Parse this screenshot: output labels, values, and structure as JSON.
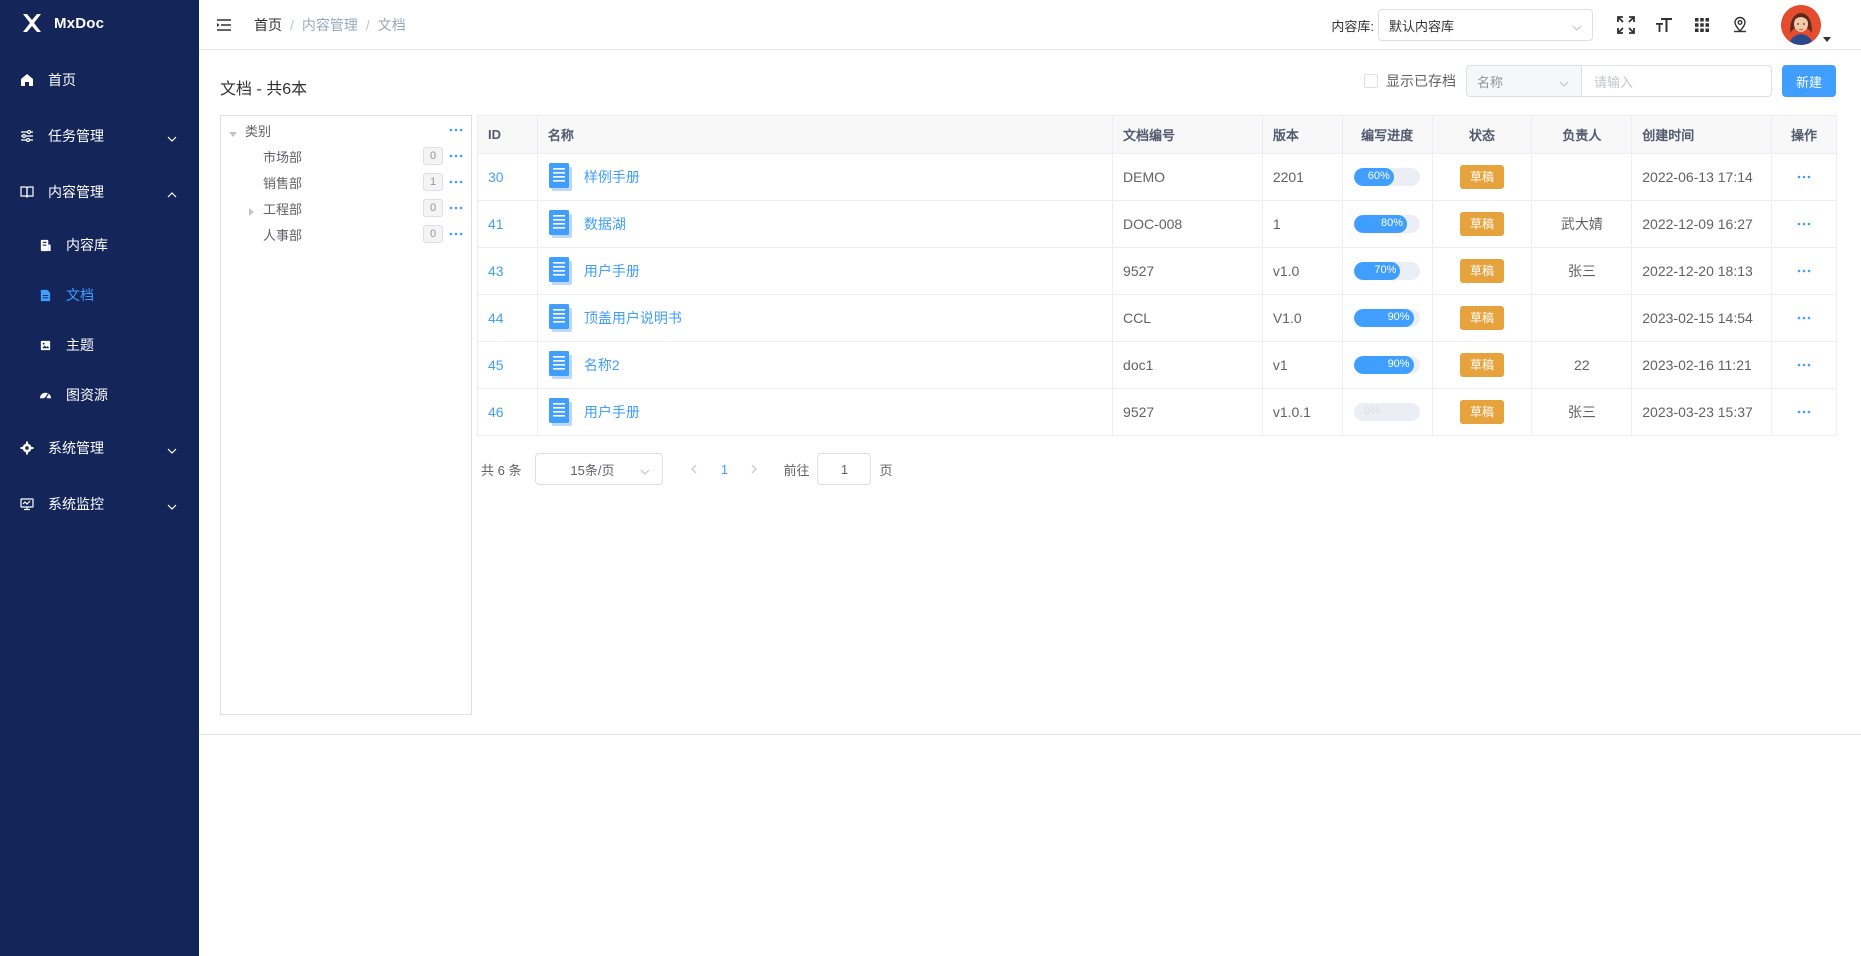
{
  "app": {
    "name": "MxDoc",
    "logo_small_text": "Mxdoc"
  },
  "colors": {
    "sidebar_bg": "#14255a",
    "primary": "#409eff",
    "draft_tag": "#e6a23c"
  },
  "sidebar": {
    "items": [
      {
        "label": "首页",
        "icon": "home-icon"
      },
      {
        "label": "任务管理",
        "icon": "sliders-icon",
        "expanded": false
      },
      {
        "label": "内容管理",
        "icon": "book-icon",
        "expanded": true,
        "children": [
          {
            "label": "内容库",
            "icon": "library-icon"
          },
          {
            "label": "文档",
            "icon": "document-icon",
            "active": true
          },
          {
            "label": "主题",
            "icon": "image-icon"
          },
          {
            "label": "图资源",
            "icon": "dashboard-icon"
          }
        ]
      },
      {
        "label": "系统管理",
        "icon": "gear-icon",
        "expanded": false
      },
      {
        "label": "系统监控",
        "icon": "monitor-icon",
        "expanded": false
      }
    ]
  },
  "header": {
    "breadcrumb": [
      "首页",
      "内容管理",
      "文档"
    ],
    "breadcrumb_sep": "/",
    "repo_label": "内容库:",
    "repo_value": "默认内容库"
  },
  "page": {
    "title": "文档 - 共6本",
    "show_archived_label": "显示已存档",
    "filter_field": "名称",
    "filter_placeholder": "请输入",
    "new_button": "新建"
  },
  "tree": {
    "root": "类别",
    "nodes": [
      {
        "label": "市场部",
        "count": "0",
        "has_children": false
      },
      {
        "label": "销售部",
        "count": "1",
        "has_children": false
      },
      {
        "label": "工程部",
        "count": "0",
        "has_children": true
      },
      {
        "label": "人事部",
        "count": "0",
        "has_children": false
      }
    ]
  },
  "table": {
    "columns": [
      "ID",
      "名称",
      "文档编号",
      "版本",
      "编写进度",
      "状态",
      "负责人",
      "创建时间",
      "操作"
    ],
    "rows": [
      {
        "id": "30",
        "name": "样例手册",
        "code": "DEMO",
        "version": "2201",
        "progress": 60,
        "progress_label": "60%",
        "status": "草稿",
        "owner": "",
        "created": "2022-06-13 17:14"
      },
      {
        "id": "41",
        "name": "数据湖",
        "code": "DOC-008",
        "version": "1",
        "progress": 80,
        "progress_label": "80%",
        "status": "草稿",
        "owner": "武大婧",
        "created": "2022-12-09 16:27"
      },
      {
        "id": "43",
        "name": "用户手册",
        "code": "9527",
        "version": "v1.0",
        "progress": 70,
        "progress_label": "70%",
        "status": "草稿",
        "owner": "张三",
        "created": "2022-12-20 18:13"
      },
      {
        "id": "44",
        "name": "顶盖用户说明书",
        "code": "CCL",
        "version": "V1.0",
        "progress": 90,
        "progress_label": "90%",
        "status": "草稿",
        "owner": "",
        "created": "2023-02-15 14:54"
      },
      {
        "id": "45",
        "name": "名称2",
        "code": "doc1",
        "version": "v1",
        "progress": 90,
        "progress_label": "90%",
        "status": "草稿",
        "owner": "22",
        "created": "2023-02-16 11:21"
      },
      {
        "id": "46",
        "name": "用户手册",
        "code": "9527",
        "version": "v1.0.1",
        "progress": 0,
        "progress_label": "0%",
        "status": "草稿",
        "owner": "张三",
        "created": "2023-03-23 15:37"
      }
    ]
  },
  "pagination": {
    "total_label": "共 6 条",
    "page_size": "15条/页",
    "current_page": "1",
    "goto_label": "前往",
    "goto_value": "1",
    "page_suffix": "页"
  }
}
